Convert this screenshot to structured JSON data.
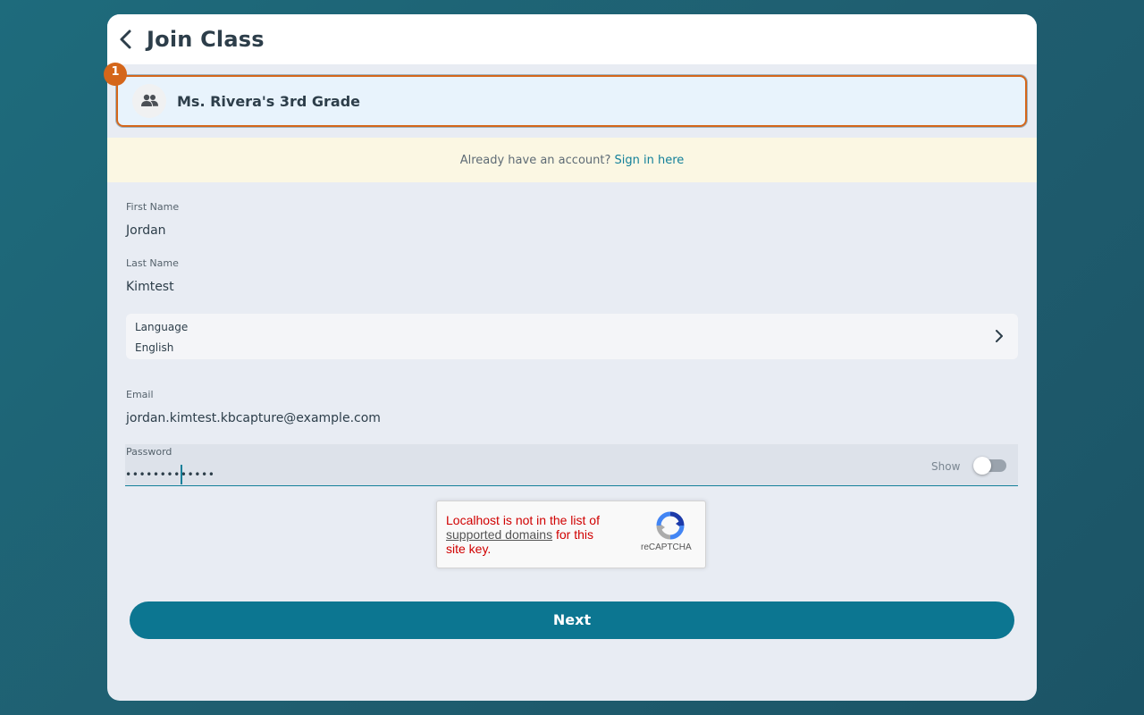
{
  "header": {
    "title": "Join Class"
  },
  "class_card": {
    "name": "Ms. Rivera's 3rd Grade",
    "step_badge": "1"
  },
  "signin_banner": {
    "prompt": "Already have an account?",
    "link": "Sign in here"
  },
  "form": {
    "first_name": {
      "label": "First Name",
      "value": "Jordan"
    },
    "last_name": {
      "label": "Last Name",
      "value": "Kimtest"
    },
    "language": {
      "label": "Language",
      "value": "English"
    },
    "email": {
      "label": "Email",
      "value": "jordan.kimtest.kbcapture@example.com"
    },
    "password": {
      "label": "Password",
      "masked_value": "•••••••••••••",
      "show_label": "Show",
      "show_enabled": false
    }
  },
  "captcha": {
    "error_line1": "Localhost is not in the list of",
    "error_link": "supported domains",
    "error_line2": "for this",
    "error_line3": "site key.",
    "brand": "reCAPTCHA"
  },
  "actions": {
    "next_label": "Next"
  },
  "colors": {
    "accent": "#0c7691",
    "highlight": "#d4661a",
    "banner_bg": "#fbf7e3",
    "error_red": "#d00000"
  },
  "icons": {
    "back": "chevron-left-icon",
    "class_avatar": "group-icon",
    "language_chevron": "chevron-right-icon",
    "captcha": "recaptcha-logo-icon"
  }
}
